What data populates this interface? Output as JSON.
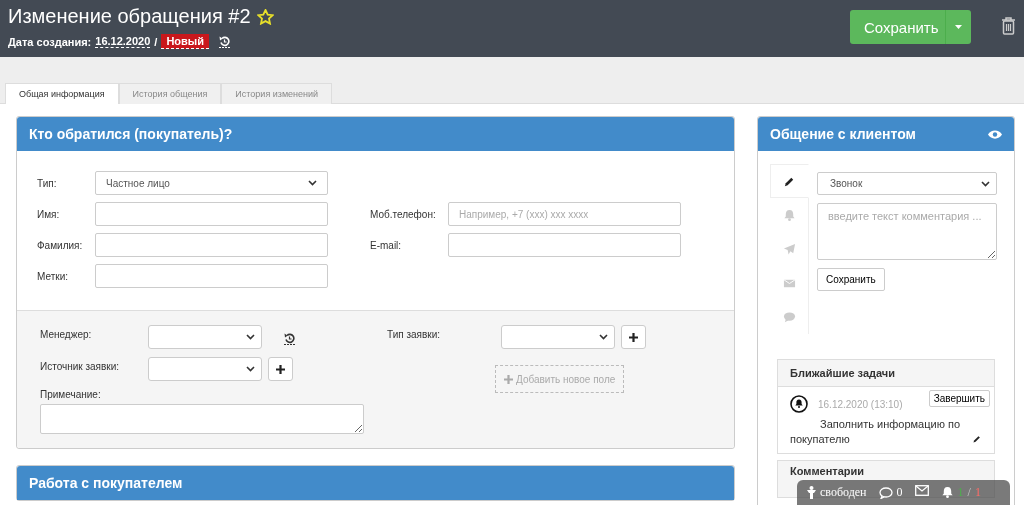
{
  "header": {
    "title": "Изменение обращения #2",
    "created_label": "Дата создания:",
    "created_date": "16.12.2020",
    "separator": "/",
    "status": "Новый",
    "save_button": "Сохранить"
  },
  "tabs": [
    {
      "label": "Общая информация",
      "selected": true
    },
    {
      "label": "История общения",
      "selected": false
    },
    {
      "label": "История изменений",
      "selected": false
    }
  ],
  "customer_panel": {
    "title": "Кто обратился (покупатель)?",
    "left_fields": [
      {
        "label": "Тип:",
        "kind": "select",
        "value": "Частное лицо"
      },
      {
        "label": "Имя:",
        "kind": "input"
      },
      {
        "label": "Фамилия:",
        "kind": "input"
      },
      {
        "label": "Метки:",
        "kind": "input"
      }
    ],
    "right_fields": [
      {
        "label": "Моб.телефон:",
        "kind": "input",
        "placeholder": "Например, +7 (xxx) xxx xxxx"
      },
      {
        "label": "E-mail:",
        "kind": "input"
      }
    ]
  },
  "details": {
    "manager_label": "Менеджер:",
    "source_label": "Источник заявки:",
    "type_label": "Тип заявки:",
    "add_field_button": "Добавить новое поле",
    "note_label": "Примечание:"
  },
  "work_panel": {
    "title": "Работа с покупателем"
  },
  "communication": {
    "title": "Общение с клиентом",
    "channels": [
      {
        "kind": "pencil",
        "selected": true
      },
      {
        "kind": "bell",
        "selected": false
      },
      {
        "kind": "plane",
        "selected": false
      },
      {
        "kind": "mail",
        "selected": false
      },
      {
        "kind": "chat",
        "selected": false
      }
    ],
    "type_value": "Звонок",
    "comment_placeholder": "введите текст комментария ...",
    "save_button": "Сохранить"
  },
  "tasks": {
    "title": "Ближайшие задачи",
    "items": [
      {
        "date": "16.12.2020 (13:10)",
        "text": "Заполнить информацию по покупателю",
        "button": "Завершить"
      }
    ]
  },
  "comments": {
    "title": "Комментарии"
  },
  "status_bar": {
    "status": "свободен",
    "messages": "0",
    "done": "1",
    "separator": "/",
    "total": "1"
  }
}
